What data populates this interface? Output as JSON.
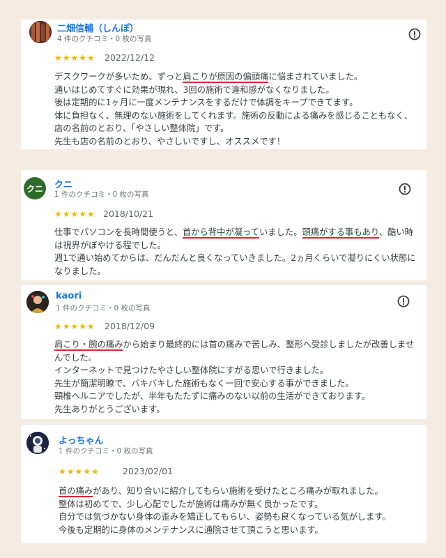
{
  "reviews": [
    {
      "name": "二畑信輔（しんぽ）",
      "meta": "4 件のクチコミ・0 枚の写真",
      "stars": "★★★★★",
      "date": "2022/12/12",
      "lines": [
        {
          "pre": "デスクワークが多いため、ずっと",
          "hl": "肩こりが原因の偏頭痛",
          "post": "に悩まされていました。"
        },
        {
          "text": "通いはじめてすぐに効果が現れ、3回の施術で違和感がなくなりました。"
        },
        {
          "text": "後は定期的に1ヶ月に一度メンテナンスをするだけで体調をキープできてます。"
        },
        {
          "text": "体に負担なく、無理のない施術をしてくれます。施術の反動による痛みを感じることもなく、店の名前のとおり、「やさしい整体院」です。"
        },
        {
          "text": "先生も店の名前のとおり、やさしいですし、オススメです！"
        }
      ]
    },
    {
      "name": "クニ",
      "avatar_text": "クニ",
      "meta": "1 件のクチコミ・0 枚の写真",
      "stars": "★★★★★",
      "date": "2018/10/21",
      "lines": [
        {
          "pre": "仕事でパソコンを長時間使うと、",
          "hl": "首から背中が凝って",
          "mid": "いました。",
          "hl2": "頭痛がする事もあり",
          "post": "、酷い時は視界がぼやける程でした。"
        },
        {
          "text": "週1で通い始めてからは、だんだんと良くなっていきました。2ヵ月くらいで凝りにくい状態になりました。"
        }
      ]
    },
    {
      "name": "kaori",
      "meta": "1 件のクチコミ・0 枚の写真",
      "stars": "★★★★★",
      "date": "2018/12/09",
      "lines": [
        {
          "hl": "肩こり・腕の痛み",
          "post": "から始まり最終的には首の痛みで苦しみ、整形へ受診しましたが改善しませんでした。"
        },
        {
          "text": "インターネットで見つけたやさしい整体院にすがる思いで行きました。"
        },
        {
          "text": "先生が簡潔明瞭で、バキバキした施術もなく一回で安心する事ができました。"
        },
        {
          "text": "頸椎ヘルニアでしたが、半年もたたずに痛みのない以前の生活ができております。"
        },
        {
          "text": "先生ありがとうございます。"
        }
      ]
    },
    {
      "name": "よっちゃん",
      "meta": "1 件のクチコミ・0 枚の写真",
      "stars": "★★★★★",
      "date": "2023/02/01",
      "lines": [
        {
          "hl": "首の痛み",
          "post": "があり、知り合いに紹介してもらい施術を受けたところ痛みが取れました。"
        },
        {
          "text": "整体は初めてで、少し心配でしたが施術は痛みが無く良かったです。"
        },
        {
          "text": "自分では気づかない身体の歪みを矯正してもらい、姿勢も良くなっている気がします。"
        },
        {
          "text": "今後も定期的に身体のメンテナンスに通院させて頂こうと思います。"
        }
      ]
    }
  ],
  "colors": {
    "background": "#f4ebe3",
    "name_link": "#1a73e8",
    "stars": "#f4b400",
    "underline": "#e0242b"
  },
  "icons": {
    "report": "exclamation-circle-icon"
  }
}
